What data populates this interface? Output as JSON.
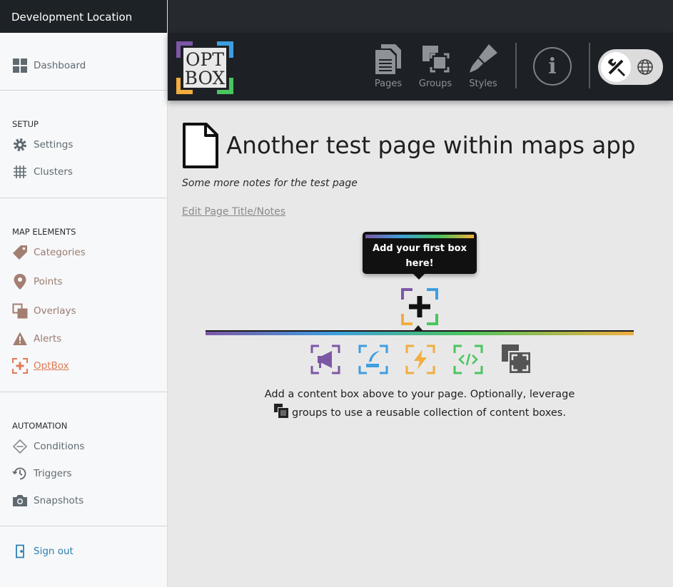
{
  "sidebar": {
    "header": "Development Location",
    "dashboard": "Dashboard",
    "setup": {
      "title": "SETUP",
      "settings": "Settings",
      "clusters": "Clusters"
    },
    "map_elements": {
      "title": "MAP ELEMENTS",
      "categories": "Categories",
      "points": "Points",
      "overlays": "Overlays",
      "alerts": "Alerts",
      "optbox": "OptBox"
    },
    "automation": {
      "title": "AUTOMATION",
      "conditions": "Conditions",
      "triggers": "Triggers",
      "snapshots": "Snapshots"
    },
    "sign_out": "Sign out"
  },
  "toolbar": {
    "logo_top": "OPT",
    "logo_bottom": "BOX",
    "pages": "Pages",
    "groups": "Groups",
    "styles": "Styles",
    "info": "i"
  },
  "page": {
    "title": "Another test page within maps app",
    "notes": "Some more notes for the test page",
    "edit_link": "Edit Page Title/Notes"
  },
  "tooltip": {
    "line1": "Add your first box",
    "line2": "here!"
  },
  "description": {
    "line1": "Add a content box above to your page. Optionally, leverage",
    "line2": "groups to use a reusable collection of content boxes."
  },
  "colors": {
    "purple": "#7d57a6",
    "blue": "#3d9ee0",
    "green": "#4ac55f",
    "orange": "#f2ad3e"
  }
}
